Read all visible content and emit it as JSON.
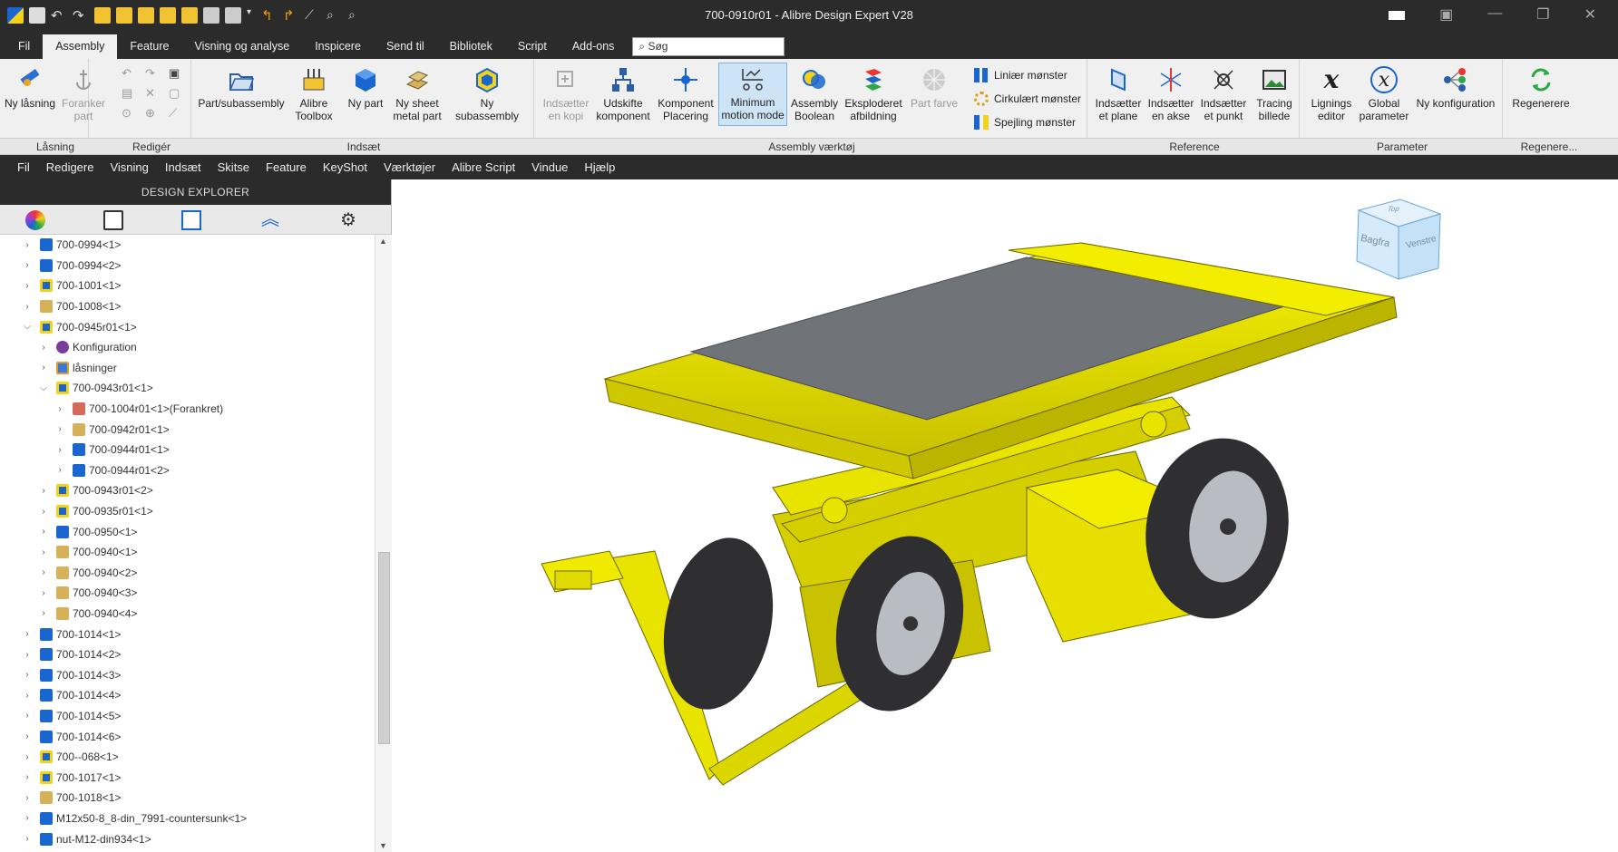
{
  "window": {
    "title": "700-0910r01 - Alibre Design Expert V28"
  },
  "ribbon_tabs": [
    "Fil",
    "Assembly",
    "Feature",
    "Visning og analyse",
    "Inspicere",
    "Send til",
    "Bibliotek",
    "Script",
    "Add-ons"
  ],
  "search": {
    "placeholder": "Søg"
  },
  "ribbon": {
    "ny_losning": "Ny låsning",
    "foranker_part": "Foranker part",
    "part_subassembly": "Part/subassembly",
    "alibre_toolbox": "Alibre Toolbox",
    "ny_part": "Ny part",
    "ny_sheet": "Ny sheet metal part",
    "ny_subassembly": "Ny subassembly",
    "indsaetter_kopi": "Indsætter en kopi",
    "udskifte": "Udskifte komponent",
    "komponent_placering": "Komponent Placering",
    "minimum_motion": "Minimum motion mode",
    "assembly_boolean": "Assembly Boolean",
    "eksploderet": "Eksploderet afbildning",
    "part_farve": "Part farve",
    "linear": "Liniær mønster",
    "cirkular": "Cirkulært mønster",
    "spejling": "Spejling mønster",
    "plane": "Indsætter et plane",
    "akse": "Indsætter en akse",
    "punkt": "Indsætter et punkt",
    "tracing": "Tracing billede",
    "lignings": "Lignings editor",
    "global": "Global parameter",
    "ny_konfig": "Ny konfiguration",
    "regenerere": "Regenerere"
  },
  "groups": [
    "Låsning",
    "Redigér",
    "Indsæt",
    "Assembly værktøj",
    "Reference",
    "Parameter",
    "Regenere..."
  ],
  "menubar": [
    "Fil",
    "Redigere",
    "Visning",
    "Indsæt",
    "Skitse",
    "Feature",
    "KeyShot",
    "Værktøjer",
    "Alibre Script",
    "Vindue",
    "Hjælp"
  ],
  "explorer": {
    "title": "DESIGN EXPLORER",
    "tree": [
      {
        "label": "700-0994<1>",
        "icon": "part",
        "level": 1
      },
      {
        "label": "700-0994<2>",
        "icon": "part",
        "level": 1
      },
      {
        "label": "700-1001<1>",
        "icon": "asm",
        "level": 1
      },
      {
        "label": "700-1008<1>",
        "icon": "sheet",
        "level": 1
      },
      {
        "label": "700-0945r01<1>",
        "icon": "asm",
        "level": 1,
        "open": true
      },
      {
        "label": "Konfiguration",
        "icon": "cfg",
        "level": 2
      },
      {
        "label": "låsninger",
        "icon": "con",
        "level": 2
      },
      {
        "label": "700-0943r01<1>",
        "icon": "asm",
        "level": 2,
        "open": true
      },
      {
        "label": "700-1004r01<1>(Forankret)",
        "icon": "anch",
        "level": 3
      },
      {
        "label": "700-0942r01<1>",
        "icon": "sheet",
        "level": 3
      },
      {
        "label": "700-0944r01<1>",
        "icon": "part",
        "level": 3
      },
      {
        "label": "700-0944r01<2>",
        "icon": "part",
        "level": 3
      },
      {
        "label": "700-0943r01<2>",
        "icon": "asm",
        "level": 2
      },
      {
        "label": "700-0935r01<1>",
        "icon": "asm",
        "level": 2
      },
      {
        "label": "700-0950<1>",
        "icon": "part",
        "level": 2
      },
      {
        "label": "700-0940<1>",
        "icon": "sheet",
        "level": 2
      },
      {
        "label": "700-0940<2>",
        "icon": "sheet",
        "level": 2
      },
      {
        "label": "700-0940<3>",
        "icon": "sheet",
        "level": 2
      },
      {
        "label": "700-0940<4>",
        "icon": "sheet",
        "level": 2
      },
      {
        "label": "700-1014<1>",
        "icon": "part",
        "level": 1
      },
      {
        "label": "700-1014<2>",
        "icon": "part",
        "level": 1
      },
      {
        "label": "700-1014<3>",
        "icon": "part",
        "level": 1
      },
      {
        "label": "700-1014<4>",
        "icon": "part",
        "level": 1
      },
      {
        "label": "700-1014<5>",
        "icon": "part",
        "level": 1
      },
      {
        "label": "700-1014<6>",
        "icon": "part",
        "level": 1
      },
      {
        "label": "700--068<1>",
        "icon": "asm",
        "level": 1
      },
      {
        "label": "700-1017<1>",
        "icon": "asm",
        "level": 1
      },
      {
        "label": "700-1018<1>",
        "icon": "sheet",
        "level": 1
      },
      {
        "label": "M12x50-8_8-din_7991-countersunk<1>",
        "icon": "part",
        "level": 1
      },
      {
        "label": "nut-M12-din934<1>",
        "icon": "part",
        "level": 1
      }
    ]
  },
  "viewcube": {
    "front": "Bagfra",
    "side": "Venstre",
    "top": "Top"
  },
  "colors": {
    "model": "#f0ea00",
    "deck": "#707378",
    "tire": "#2f2f32",
    "hub": "#b9bcc2"
  }
}
